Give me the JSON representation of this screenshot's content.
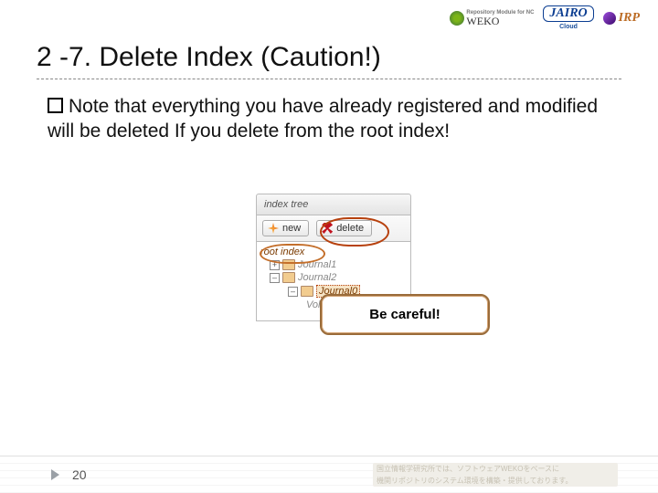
{
  "logos": {
    "weko": "WEKO",
    "weko_sub": "Repository Module for NC",
    "jairo": "JAIRO",
    "jairo_sub": "Cloud",
    "irp": "IRP"
  },
  "title": "2 -7. Delete Index (Caution!)",
  "body": "Note that everything you have already registered and modified will be deleted If you delete from the root index!",
  "panel": {
    "header": "index tree",
    "btn_new": "new",
    "btn_delete": "delete",
    "root": "root index",
    "items": [
      "Journal1",
      "Journal2",
      "Journal0",
      "Vol1"
    ]
  },
  "callout": "Be careful!",
  "page_number": "20"
}
